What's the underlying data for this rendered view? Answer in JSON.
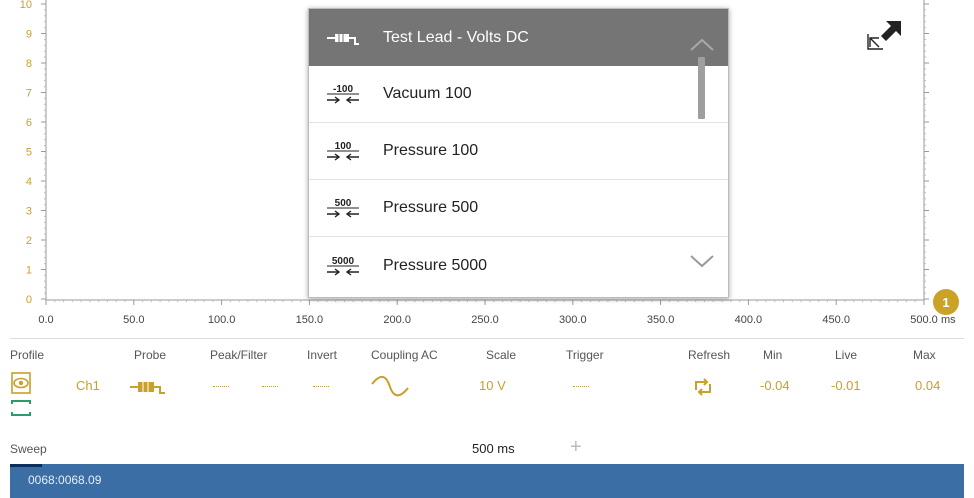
{
  "graph": {
    "y_ticks": [
      "10",
      "9",
      "8",
      "7",
      "6",
      "5",
      "4",
      "3",
      "2",
      "1",
      "0"
    ],
    "x_ticks": [
      "0.0",
      "50.0",
      "100.0",
      "150.0",
      "200.0",
      "250.0",
      "300.0",
      "350.0",
      "400.0",
      "450.0",
      "500.0"
    ],
    "x_unit": "ms",
    "marker_label": "1"
  },
  "dropdown": {
    "items": [
      {
        "label": "Test Lead - Volts DC",
        "icon": "test-lead-icon",
        "selected": true
      },
      {
        "label": "Vacuum 100",
        "icon": "vacuum-100-icon",
        "icon_text": "-100"
      },
      {
        "label": "Pressure 100",
        "icon": "pressure-100-icon",
        "icon_text": "100"
      },
      {
        "label": "Pressure 500",
        "icon": "pressure-500-icon",
        "icon_text": "500"
      },
      {
        "label": "Pressure 5000",
        "icon": "pressure-5000-icon",
        "icon_text": "5000"
      }
    ]
  },
  "panel": {
    "headers": {
      "profile": "Profile",
      "probe": "Probe",
      "peak_filter": "Peak/Filter",
      "invert": "Invert",
      "coupling": "Coupling AC",
      "scale": "Scale",
      "trigger": "Trigger",
      "refresh": "Refresh",
      "min": "Min",
      "live": "Live",
      "max": "Max"
    },
    "values": {
      "channel": "Ch1",
      "scale": "10 V",
      "min": "-0.04",
      "live": "-0.01",
      "max": "0.04"
    },
    "sweep_label": "Sweep",
    "sweep_value": "500 ms",
    "sweep_plus": "+"
  },
  "status_bar": {
    "text": "0068:0068.09"
  },
  "colors": {
    "accent": "#c8a02a",
    "selected_item_bg": "#757575",
    "status_bar": "#3a6ea5",
    "profile_green": "#2a9d6a"
  }
}
